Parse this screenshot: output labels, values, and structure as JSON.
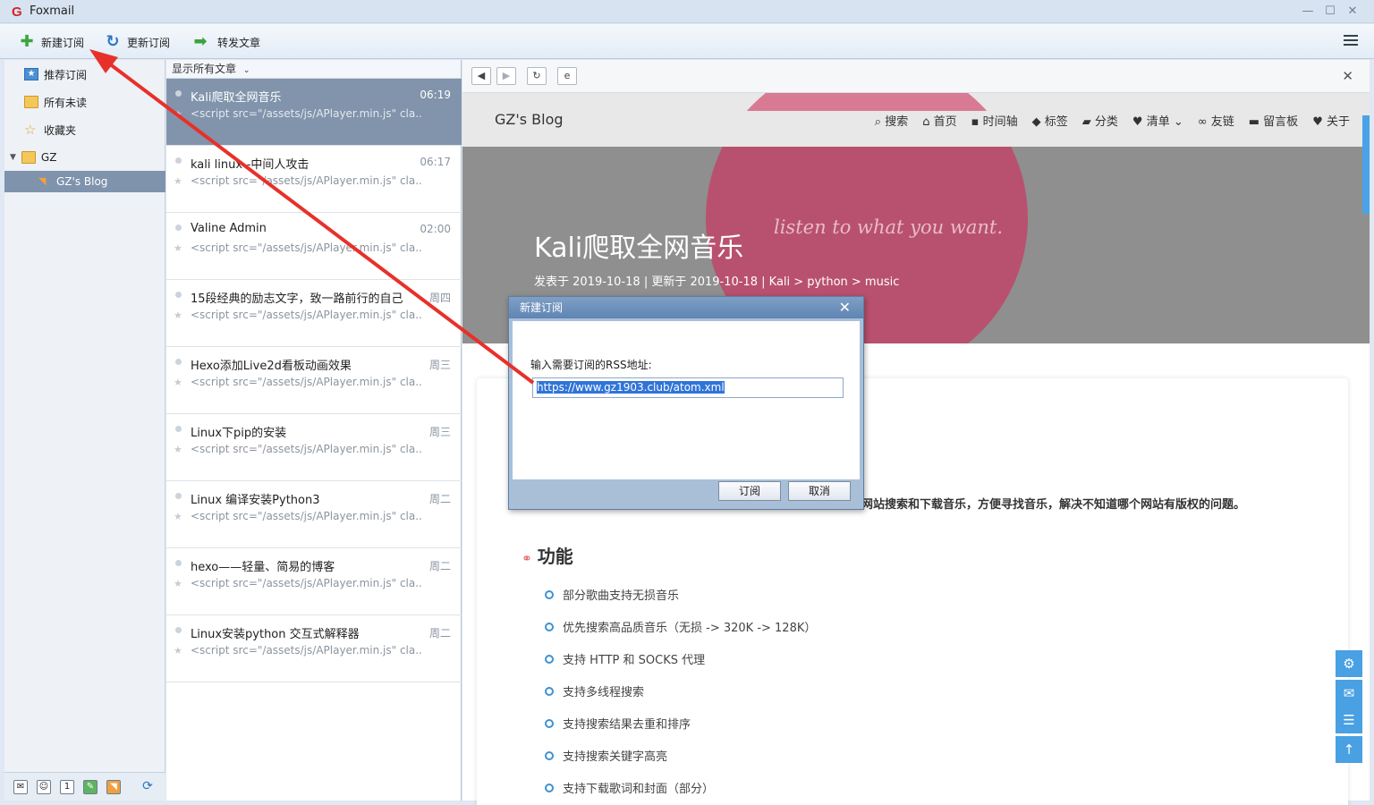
{
  "window": {
    "app_name": "Foxmail",
    "logo": "G"
  },
  "toolbar": {
    "new_sub": "新建订阅",
    "update_sub": "更新订阅",
    "forward": "转发文章"
  },
  "left": {
    "items": [
      "推荐订阅",
      "所有未读",
      "收藏夹",
      "GZ",
      "GZ's Blog"
    ]
  },
  "mid": {
    "filter": "显示所有文章",
    "articles": [
      {
        "title": "Kali爬取全网音乐",
        "time": "06:19",
        "snippet": "<script src=\"/assets/js/APlayer.min.js\" cla..."
      },
      {
        "title": "kali linux--中间人攻击",
        "time": "06:17",
        "snippet": "<script src=\"/assets/js/APlayer.min.js\" cla..."
      },
      {
        "title": "Valine Admin",
        "time": "02:00",
        "snippet": "<script src=\"/assets/js/APlayer.min.js\" cla..."
      },
      {
        "title": "15段经典的励志文字，致一路前行的自己",
        "time": "周四",
        "snippet": "<script src=\"/assets/js/APlayer.min.js\" cla..."
      },
      {
        "title": "Hexo添加Live2d看板动画效果",
        "time": "周三",
        "snippet": "<script src=\"/assets/js/APlayer.min.js\" cla..."
      },
      {
        "title": "Linux下pip的安装",
        "time": "周三",
        "snippet": "<script src=\"/assets/js/APlayer.min.js\" cla..."
      },
      {
        "title": "Linux 编译安装Python3",
        "time": "周二",
        "snippet": "<script src=\"/assets/js/APlayer.min.js\" cla..."
      },
      {
        "title": "hexo——轻量、简易的博客",
        "time": "周二",
        "snippet": "<script src=\"/assets/js/APlayer.min.js\" cla..."
      },
      {
        "title": "Linux安装python 交互式解释器",
        "time": "周二",
        "snippet": "<script src=\"/assets/js/APlayer.min.js\" cla..."
      }
    ]
  },
  "blog": {
    "brand": "GZ's Blog",
    "nav": [
      "搜索",
      "首页",
      "时间轴",
      "标签",
      "分类",
      "清单",
      "友链",
      "留言板",
      "关于"
    ],
    "tagline": "listen to what you want.",
    "title": "Kali爬取全网音乐",
    "meta": "发表于 2019-10-18 | 更新于 2019-10-18 | Kali > python > music",
    "intro": "网站搜索和下载音乐，方便寻找音乐，解决不知道哪个网站有版权的问题。",
    "section": "功能",
    "features": [
      "部分歌曲支持无损音乐",
      "优先搜索高品质音乐（无损 -> 320K -> 128K）",
      "支持 HTTP 和 SOCKS 代理",
      "支持多线程搜索",
      "支持搜索结果去重和排序",
      "支持搜索关键字高亮",
      "支持下载歌词和封面（部分）"
    ]
  },
  "dialog": {
    "title": "新建订阅",
    "label": "输入需要订阅的RSS地址:",
    "url": "https://www.gz1903.club/atom.xml",
    "ok": "订阅",
    "cancel": "取消"
  }
}
